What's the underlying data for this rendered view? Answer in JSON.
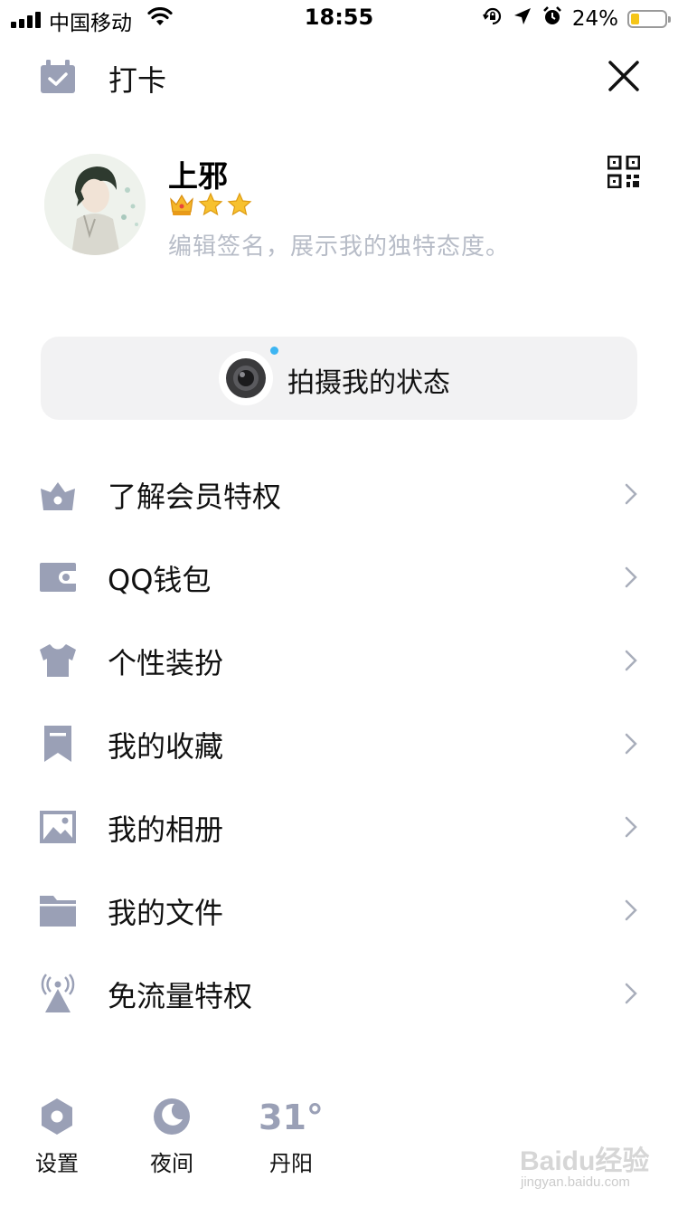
{
  "status_bar": {
    "carrier": "中国移动",
    "time": "18:55",
    "battery_percent": "24%",
    "battery_level": 0.24,
    "icons": [
      "signal-icon",
      "wifi-icon",
      "rotation-lock-icon",
      "location-icon",
      "alarm-icon",
      "battery-icon"
    ]
  },
  "header": {
    "checkin_label": "打卡",
    "icons": [
      "calendar-check-icon",
      "close-icon"
    ]
  },
  "profile": {
    "nickname": "上邪",
    "signature": "编辑签名，展示我的独特态度。",
    "badges": [
      "crown-icon",
      "star-icon",
      "star-icon"
    ],
    "icons": [
      "avatar",
      "qr-code-icon"
    ]
  },
  "shoot": {
    "label": "拍摄我的状态",
    "icon": "camera-icon",
    "accent": "#3db5f2"
  },
  "menu": {
    "items": [
      {
        "label": "了解会员特权",
        "icon": "vip-crown-icon"
      },
      {
        "label": "QQ钱包",
        "icon": "wallet-icon"
      },
      {
        "label": "个性装扮",
        "icon": "tshirt-icon"
      },
      {
        "label": "我的收藏",
        "icon": "bookmark-icon"
      },
      {
        "label": "我的相册",
        "icon": "photo-icon"
      },
      {
        "label": "我的文件",
        "icon": "folder-icon"
      },
      {
        "label": "免流量特权",
        "icon": "signal-tower-icon"
      }
    ],
    "icon_color": "#9aa0b6"
  },
  "bottom_bar": {
    "settings_label": "设置",
    "night_label": "夜间",
    "weather_temp": "31°",
    "weather_city": "丹阳"
  },
  "watermark": {
    "logo_text": "Baidu经验",
    "url": "jingyan.baidu.com"
  }
}
